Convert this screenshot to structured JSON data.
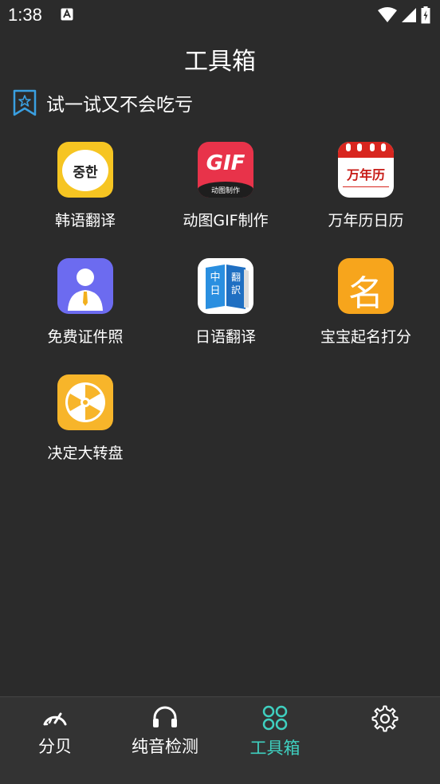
{
  "status": {
    "time": "1:38"
  },
  "header": {
    "title": "工具箱"
  },
  "section": {
    "title": "试一试又不会吃亏"
  },
  "tools": [
    {
      "label": "韩语翻译",
      "icon": "korean-translate-icon",
      "icon_text": "중한"
    },
    {
      "label": "动图GIF制作",
      "icon": "gif-maker-icon",
      "icon_text": "GIF",
      "icon_subtext": "动图制作"
    },
    {
      "label": "万年历日历",
      "icon": "calendar-icon",
      "icon_text": "万年历"
    },
    {
      "label": "免费证件照",
      "icon": "id-photo-icon"
    },
    {
      "label": "日语翻译",
      "icon": "japanese-translate-icon",
      "icon_text": "中日",
      "icon_subtext": "翻訳"
    },
    {
      "label": "宝宝起名打分",
      "icon": "baby-name-icon",
      "icon_text": "名"
    },
    {
      "label": "决定大转盘",
      "icon": "wheel-icon"
    }
  ],
  "nav": [
    {
      "label": "分贝",
      "icon": "gauge-icon"
    },
    {
      "label": "纯音检测",
      "icon": "headphones-icon"
    },
    {
      "label": "工具箱",
      "icon": "toolbox-icon",
      "active": true
    },
    {
      "label": "",
      "icon": "gear-icon"
    }
  ],
  "colors": {
    "accent": "#3fd0c0",
    "background": "#2b2b2b"
  }
}
